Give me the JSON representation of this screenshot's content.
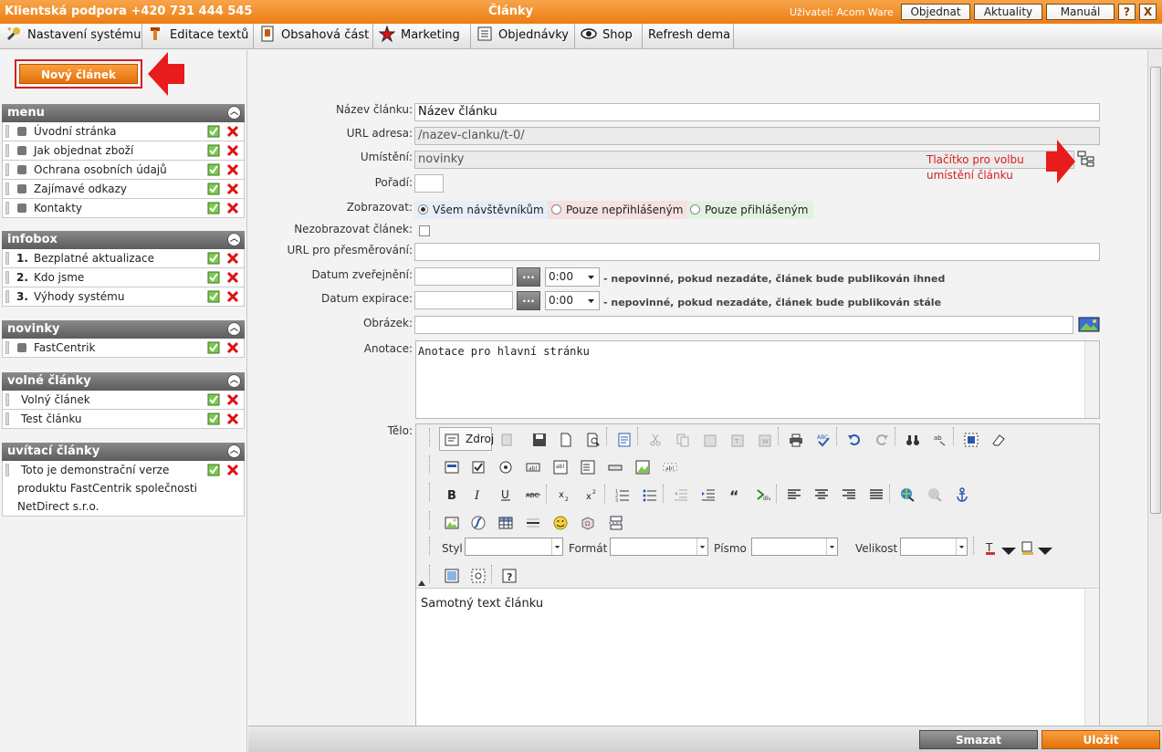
{
  "titlebar": {
    "support": "Klientská podpora +420 731 444 545",
    "title": "Články",
    "user": "Uživatel: Acom Ware",
    "buttons": [
      "Objednat",
      "Aktuality",
      "Manuál"
    ],
    "help": "?",
    "close": "X"
  },
  "menubar": {
    "items": [
      "Nastavení systému",
      "Editace textů",
      "Obsahová část",
      "Marketing",
      "Objednávky",
      "Shop",
      "Refresh dema"
    ]
  },
  "left": {
    "new_article": "Nový článek",
    "sections": [
      {
        "title": "menu",
        "items": [
          "Úvodní stránka",
          "Jak objednat zboží",
          "Ochrana osobních údajů",
          "Zajímavé odkazy",
          "Kontakty"
        ]
      },
      {
        "title": "infobox",
        "items": [
          {
            "num": "1.",
            "label": "Bezplatné aktualizace"
          },
          {
            "num": "2.",
            "label": "Kdo jsme"
          },
          {
            "num": "3.",
            "label": "Výhody systému"
          }
        ]
      },
      {
        "title": "novinky",
        "items": [
          "FastCentrik"
        ]
      },
      {
        "title": "volné články",
        "items": [
          "Volný článek",
          "Test článku"
        ]
      },
      {
        "title": "uvítací články",
        "items": [
          "Toto je demonstrační verze",
          "produktu FastCentrik společnosti",
          "NetDirect s.r.o."
        ]
      }
    ]
  },
  "form": {
    "labels": {
      "name": "Název článku:",
      "url": "URL adresa:",
      "location": "Umístění:",
      "order": "Pořadí:",
      "show": "Zobrazovat:",
      "hide": "Nezobrazovat článek:",
      "redirect": "URL pro přesměrování:",
      "publish": "Datum zveřejnění:",
      "expire": "Datum expirace:",
      "image": "Obrázek:",
      "annotation": "Anotace:",
      "body": "Tělo:"
    },
    "values": {
      "name": "Název článku",
      "url": "/nazev-clanku/t-0/",
      "location": "novinky",
      "publish_time": "0:00",
      "expire_time": "0:00",
      "annotation": "Anotace pro hlavní stránku",
      "body": "Samotný text článku"
    },
    "location_note": [
      "Tlačítko pro volbu",
      "umístění článku"
    ],
    "radios": [
      "Všem návštěvníkům",
      "Pouze nepřihlášeným",
      "Pouze přihlášeným"
    ],
    "date_button": "...",
    "publish_hint": "- nepovinné, pokud nezadáte, článek bude publikován ihned",
    "expire_hint": "- nepovinné, pokud nezadáte, článek bude publikován stále"
  },
  "editor": {
    "source": "Zdroj",
    "combos": [
      "Styl",
      "Formát",
      "Písmo",
      "Velikost"
    ]
  },
  "bottom": {
    "delete": "Smazat",
    "save": "Uložit"
  },
  "colors": {
    "accent": "#ec7d14",
    "header_gray": "#6e6e6e",
    "arrow_red": "#e81c1c",
    "note_red": "#d42020"
  }
}
